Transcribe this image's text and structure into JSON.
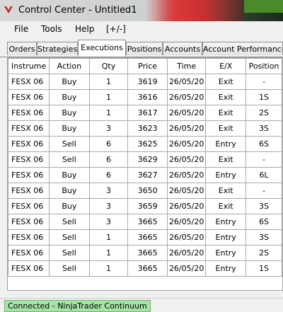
{
  "window": {
    "title": "Control Center - Untitled1"
  },
  "menu": [
    {
      "label": "File"
    },
    {
      "label": "Tools"
    },
    {
      "label": "Help"
    },
    {
      "label": "[+/-]"
    }
  ],
  "tabs": [
    {
      "label": "Orders",
      "active": false
    },
    {
      "label": "Strategies",
      "active": false
    },
    {
      "label": "Executions",
      "active": true
    },
    {
      "label": "Positions",
      "active": false
    },
    {
      "label": "Accounts",
      "active": false
    },
    {
      "label": "Account Performance",
      "active": false
    }
  ],
  "executions": {
    "columns": [
      "Instrume",
      "Action",
      "Qty",
      "Price",
      "Time",
      "E/X",
      "Position"
    ],
    "rows": [
      [
        "FESX 06",
        "Buy",
        "1",
        "3619",
        "26/05/20",
        "Exit",
        "-"
      ],
      [
        "FESX 06",
        "Buy",
        "1",
        "3616",
        "26/05/20",
        "Exit",
        "1S"
      ],
      [
        "FESX 06",
        "Buy",
        "1",
        "3617",
        "26/05/20",
        "Exit",
        "2S"
      ],
      [
        "FESX 06",
        "Buy",
        "3",
        "3623",
        "26/05/20",
        "Exit",
        "3S"
      ],
      [
        "FESX 06",
        "Sell",
        "6",
        "3625",
        "26/05/20",
        "Entry",
        "6S"
      ],
      [
        "FESX 06",
        "Sell",
        "6",
        "3629",
        "26/05/20",
        "Exit",
        "-"
      ],
      [
        "FESX 06",
        "Buy",
        "6",
        "3627",
        "26/05/20",
        "Entry",
        "6L"
      ],
      [
        "FESX 06",
        "Buy",
        "3",
        "3650",
        "26/05/20",
        "Exit",
        "-"
      ],
      [
        "FESX 06",
        "Buy",
        "3",
        "3659",
        "26/05/20",
        "Exit",
        "3S"
      ],
      [
        "FESX 06",
        "Sell",
        "3",
        "3665",
        "26/05/20",
        "Entry",
        "6S"
      ],
      [
        "FESX 06",
        "Sell",
        "1",
        "3665",
        "26/05/20",
        "Entry",
        "3S"
      ],
      [
        "FESX 06",
        "Sell",
        "1",
        "3665",
        "26/05/20",
        "Entry",
        "2S"
      ],
      [
        "FESX 06",
        "Sell",
        "1",
        "3665",
        "26/05/20",
        "Entry",
        "1S"
      ]
    ]
  },
  "status": {
    "connection": "Connected - NinjaTrader Continuum",
    "connection_color": "#a7e3a7"
  }
}
